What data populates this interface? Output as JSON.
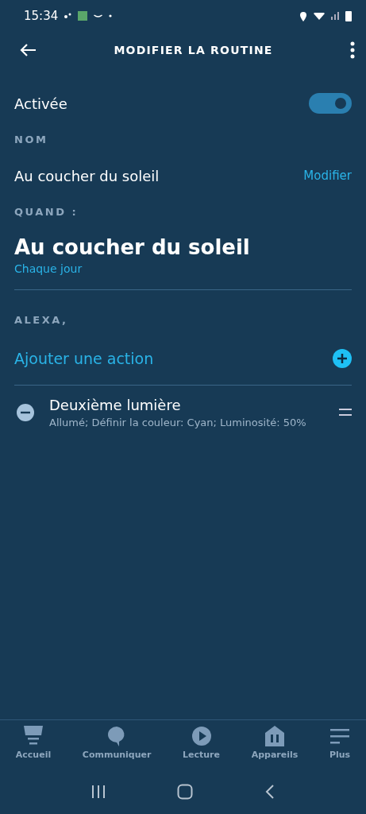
{
  "status_bar": {
    "time": "15:34"
  },
  "header": {
    "title": "MODIFIER LA ROUTINE"
  },
  "enabled": {
    "label": "Activée",
    "on": true
  },
  "name_section": {
    "heading": "NOM",
    "value": "Au coucher du soleil",
    "edit_link": "Modifier"
  },
  "when_section": {
    "heading": "QUAND :",
    "trigger": "Au coucher du soleil",
    "schedule": "Chaque jour"
  },
  "alexa_section": {
    "heading": "ALEXA,",
    "add_action": "Ajouter une action",
    "actions": [
      {
        "title": "Deuxième lumière",
        "detail": "Allumé; Définir la couleur: Cyan; Luminosité: 50%"
      }
    ]
  },
  "bottom_nav": [
    {
      "label": "Accueil",
      "kind": "home"
    },
    {
      "label": "Communiquer",
      "kind": "chat"
    },
    {
      "label": "Lecture",
      "kind": "play"
    },
    {
      "label": "Appareils",
      "kind": "devices"
    },
    {
      "label": "Plus",
      "kind": "more"
    }
  ]
}
